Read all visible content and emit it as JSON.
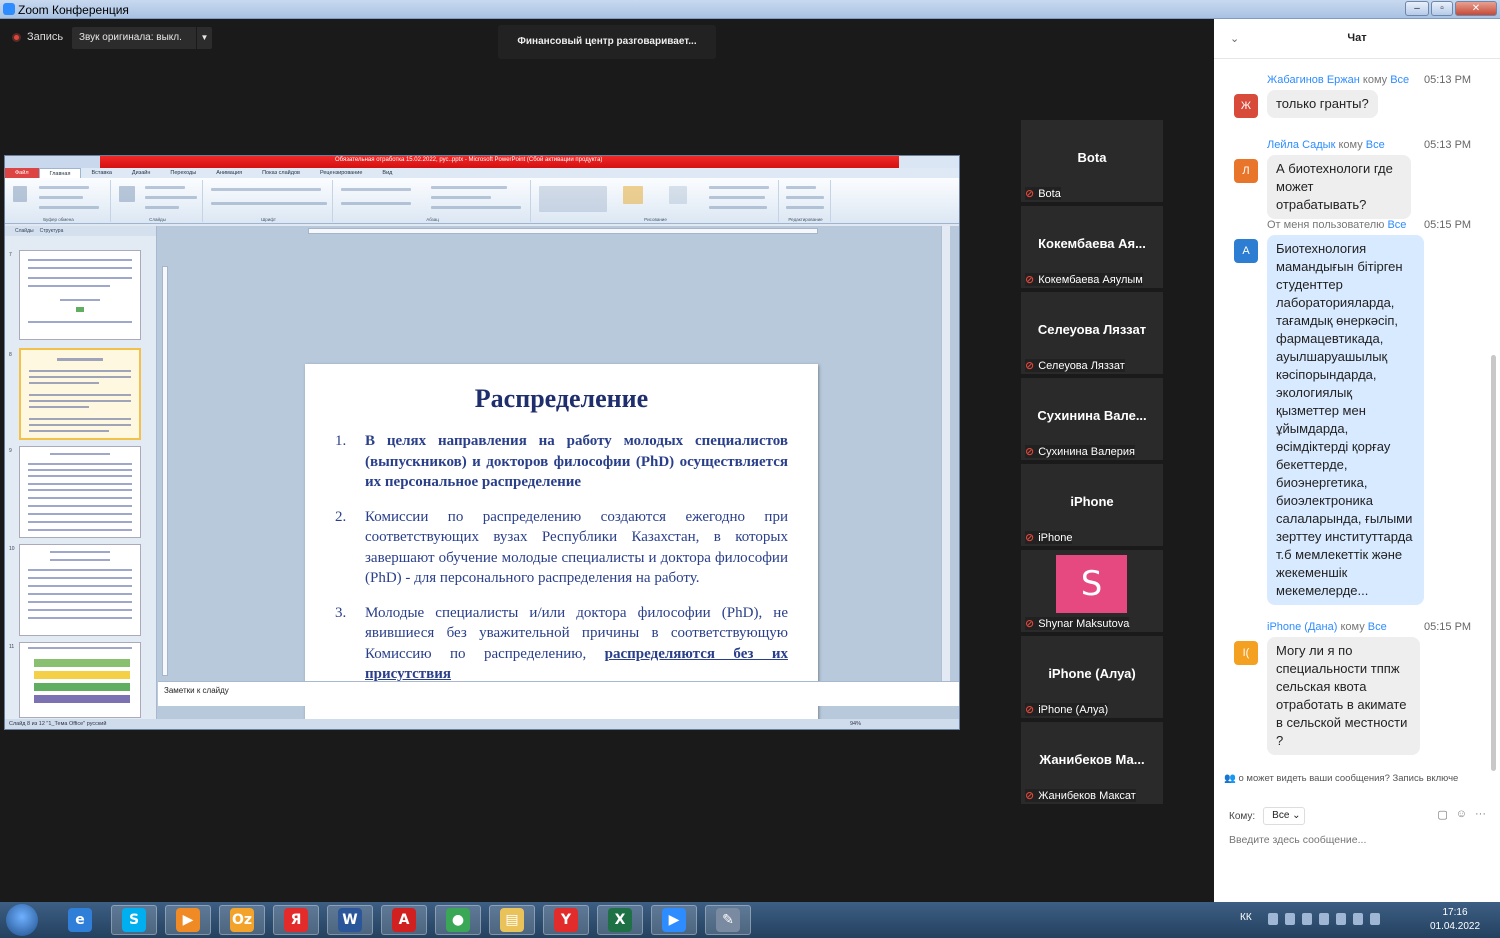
{
  "window": {
    "title": "Zoom Конференция"
  },
  "meeting": {
    "record_label": "Запись",
    "audio_label": "Звук оригинала: выкл.",
    "speaker": "Финансовый центр разговаривает...",
    "mic_icon": "mic-muted-icon"
  },
  "ppt": {
    "title": "Обязательная отработка 15.02.2022, рус..pptx - Microsoft PowerPoint (Сбой активации продукта)",
    "tabs": [
      "Файл",
      "Главная",
      "Вставка",
      "Дизайн",
      "Переходы",
      "Анимация",
      "Показ слайдов",
      "Рецензирование",
      "Вид"
    ],
    "thumb_tabs": [
      "Слайды",
      "Структура"
    ],
    "thumb_numbers": [
      "7",
      "8",
      "9",
      "10",
      "11"
    ],
    "notes_placeholder": "Заметки к слайду",
    "status": "Слайд 8 из 12   \"1_Тема Office\"   русский",
    "zoom": "94%",
    "ribbon_groups": [
      "Буфер обмена",
      "Слайды",
      "Шрифт",
      "Абзац",
      "Рисование",
      "Редактирование"
    ]
  },
  "slide": {
    "title": "Распределение",
    "items": [
      {
        "num": "1.",
        "text": "В целях направления на работу молодых специалистов (выпускников) и докторов философии (PhD) осуществляется их персональное распределение"
      },
      {
        "num": "2.",
        "text": "Комиссии по распределению создаются ежегодно при соответствующих вузах Республики Казахстан, в которых завершают обучение молодые специалисты и доктора философии (PhD) - для персонального распределения на работу."
      },
      {
        "num": "3.",
        "text": " Молодые специалисты и/или доктора философии (PhD), не явившиеся без уважительной причины в соответствующую Комиссию по распределению, ",
        "underline": "распределяются без их присутствия"
      }
    ]
  },
  "participants": [
    {
      "big": "Bota",
      "name": "Bota"
    },
    {
      "big": "Кокембаева Ая...",
      "name": "Кокембаева Аяулым"
    },
    {
      "big": "Селеуова Ляззат",
      "name": "Селеуова Ляззат"
    },
    {
      "big": "Сухинина Вале...",
      "name": "Сухинина Валерия"
    },
    {
      "big": "iPhone",
      "name": "iPhone"
    },
    {
      "big": "S",
      "name": "Shynar Maksutova",
      "avatar_color": "#e64980"
    },
    {
      "big": "iPhone (Алуа)",
      "name": "iPhone (Алуа)"
    },
    {
      "big": "Жанибеков Ма...",
      "name": "Жанибеков Максат"
    }
  ],
  "chat": {
    "title": "Чат",
    "messages": [
      {
        "sender": "Жабагинов Ержан",
        "to_word": "кому",
        "to": "Все",
        "time": "05:13 PM",
        "avatar": "Ж",
        "avatar_color": "#d84a3a",
        "text": "только гранты?"
      },
      {
        "sender": "Лейла Садык",
        "to_word": "кому",
        "to": "Все",
        "time": "05:13 PM",
        "avatar": "Л",
        "avatar_color": "#e8752a",
        "text": "А биотехнологи где может отрабатывать?"
      },
      {
        "sender": "От меня пользователю",
        "to_word": "",
        "to": "Все",
        "time": "05:15 PM",
        "avatar": "A",
        "avatar_color": "#2d7dd2",
        "text": "Биотехнология мамандығын бітірген студенттер лабораторияларда, тағамдық өнеркәсіп, фармацевтикада, ауылшаруашылық кәсіпорындарда, экологиялық қызметтер мен ұйымдарда, өсімдіктерді қорғау бекеттерде, биоэнергетика, биоэлектроника салаларында, ғылыми зерттеу институттарда т.б мемлекеттік және жекеменшік мекемелерде..."
      },
      {
        "sender": "iPhone (Дана)",
        "to_word": "кому",
        "to": "Все",
        "time": "05:15 PM",
        "avatar": "I(",
        "avatar_color": "#f4a020",
        "text": "Могу ли я по специальности тппж сельская квота отработать в акимате в сельской местности ?"
      }
    ],
    "notice": "о может видеть ваши сообщения? Запись включе",
    "to_label": "Кому:",
    "to_value": "Все",
    "input_placeholder": "Введите здесь сообщение..."
  },
  "taskbar": {
    "lang": "КК",
    "time": "17:16",
    "date": "01.04.2022",
    "apps": [
      {
        "name": "ie",
        "glyph": "e",
        "color": "#2f7fd8"
      },
      {
        "name": "skype",
        "glyph": "S",
        "color": "#00aff0"
      },
      {
        "name": "media-player",
        "glyph": "▶",
        "color": "#f08a24"
      },
      {
        "name": "outlook",
        "glyph": "Oz",
        "color": "#f3a32a"
      },
      {
        "name": "yandex",
        "glyph": "Я",
        "color": "#e32b2b"
      },
      {
        "name": "word",
        "glyph": "W",
        "color": "#2b579a"
      },
      {
        "name": "pdf",
        "glyph": "A",
        "color": "#d02020"
      },
      {
        "name": "chrome",
        "glyph": "●",
        "color": "#3aa757"
      },
      {
        "name": "explorer",
        "glyph": "▤",
        "color": "#e9c35a"
      },
      {
        "name": "yandex-browser",
        "glyph": "Y",
        "color": "#e22b2b"
      },
      {
        "name": "excel",
        "glyph": "X",
        "color": "#1e7145"
      },
      {
        "name": "zoom",
        "glyph": "▶",
        "color": "#2d8cff"
      },
      {
        "name": "tools",
        "glyph": "✎",
        "color": "#7a8aa0"
      }
    ]
  }
}
